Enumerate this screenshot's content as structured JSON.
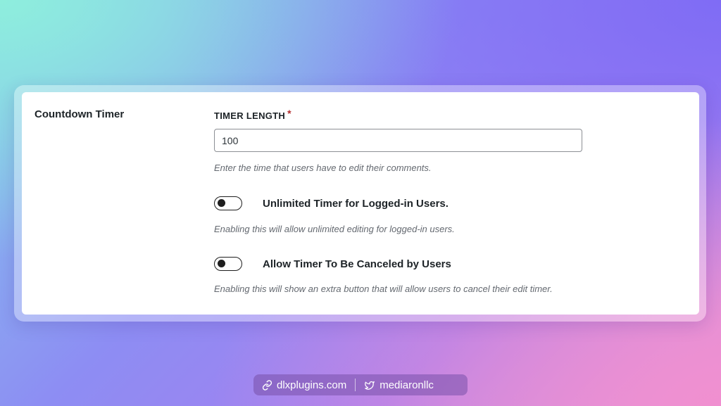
{
  "colors": {
    "required": "#b32d2e",
    "text": "#1d2327",
    "help_text": "#646970",
    "toggle": "#1e1e1e"
  },
  "settings": {
    "section_title": "Countdown Timer",
    "timer_length": {
      "label": "TIMER LENGTH",
      "required_mark": "*",
      "value": "100",
      "help": "Enter the time that users have to edit their comments."
    },
    "toggles": [
      {
        "label": "Unlimited Timer for Logged-in Users.",
        "enabled": false,
        "help": "Enabling this will allow unlimited editing for logged-in users."
      },
      {
        "label": "Allow Timer To Be Canceled by Users",
        "enabled": false,
        "help": "Enabling this will show an extra button that will allow users to cancel their edit timer."
      }
    ]
  },
  "footer": {
    "website": {
      "icon": "link-icon",
      "text": "dlxplugins.com"
    },
    "twitter": {
      "icon": "twitter-icon",
      "text": "mediaronllc"
    }
  }
}
